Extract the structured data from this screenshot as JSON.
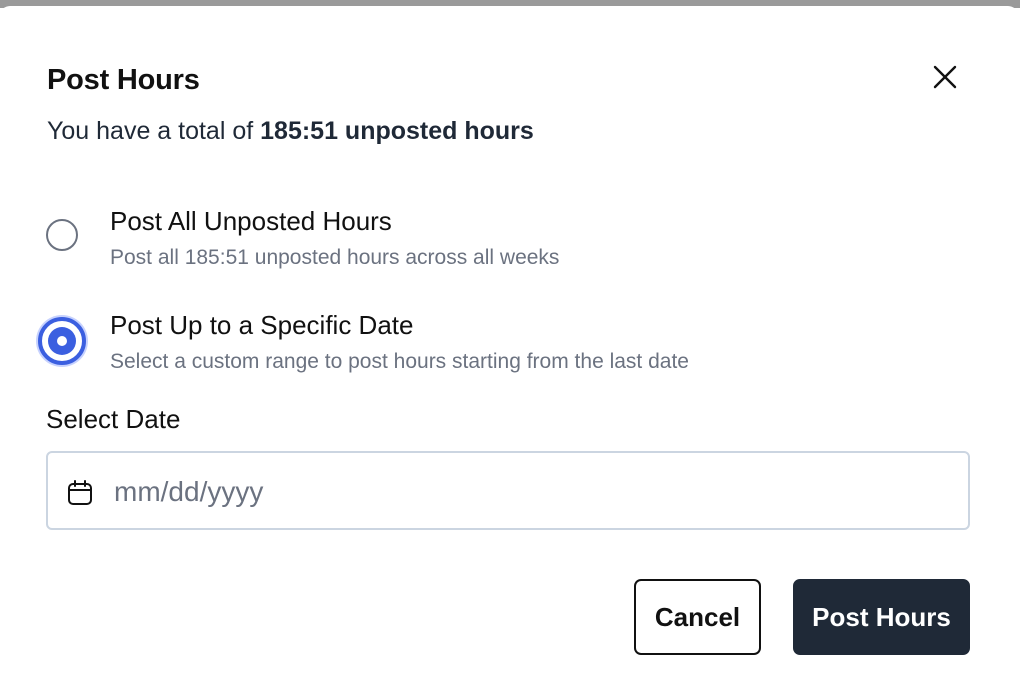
{
  "dialog": {
    "title": "Post Hours",
    "subtitle_prefix": "You have a total of ",
    "subtitle_value": "185:51 unposted hours"
  },
  "options": [
    {
      "label": "Post All Unposted Hours",
      "description": "Post all 185:51 unposted hours across all weeks",
      "selected": false
    },
    {
      "label": "Post Up to a Specific Date",
      "description": "Select a custom range to post hours starting from the last date",
      "selected": true
    }
  ],
  "date_picker": {
    "label": "Select Date",
    "value": "",
    "placeholder": "mm/dd/yyyy",
    "icon": "calendar-icon"
  },
  "actions": {
    "cancel_label": "Cancel",
    "submit_label": "Post Hours"
  },
  "icons": {
    "close": "close-icon",
    "calendar": "calendar-icon"
  },
  "colors": {
    "accent": "#3b5fe0",
    "primary_button_bg": "#1f2937",
    "muted_text": "#6b7280"
  }
}
